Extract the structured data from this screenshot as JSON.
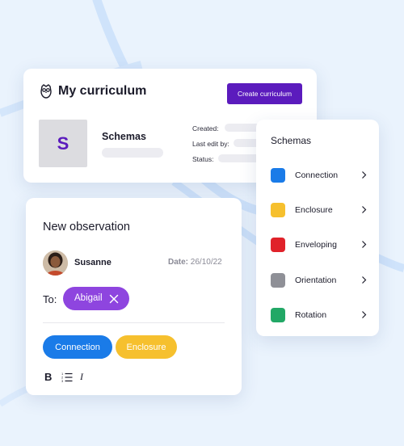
{
  "curriculum": {
    "title": "My curriculum",
    "create_button": "Create curriculum",
    "thumbnail_letter": "S",
    "schema_name": "Schemas",
    "meta": {
      "created_label": "Created:",
      "last_edit_label": "Last edit by:",
      "status_label": "Status:"
    }
  },
  "schemas_panel": {
    "title": "Schemas",
    "items": [
      {
        "label": "Connection",
        "color": "#1a7be8"
      },
      {
        "label": "Enclosure",
        "color": "#f6c02e"
      },
      {
        "label": "Enveloping",
        "color": "#e0222a"
      },
      {
        "label": "Orientation",
        "color": "#8f9097"
      },
      {
        "label": "Rotation",
        "color": "#22a866"
      }
    ]
  },
  "observation": {
    "title": "New observation",
    "person": "Susanne",
    "date_label": "Date:",
    "date_value": "26/10/22",
    "to_label": "To:",
    "recipient": "Abigail",
    "tags": [
      {
        "label": "Connection",
        "color": "#1a7be8"
      },
      {
        "label": "Enclosure",
        "color": "#f6c02e"
      }
    ],
    "toolbar": {
      "bold": "B",
      "italic": "I"
    }
  },
  "colors": {
    "accent": "#5b1bbd",
    "chip": "#8e45df",
    "background": "#eaf3fd"
  }
}
